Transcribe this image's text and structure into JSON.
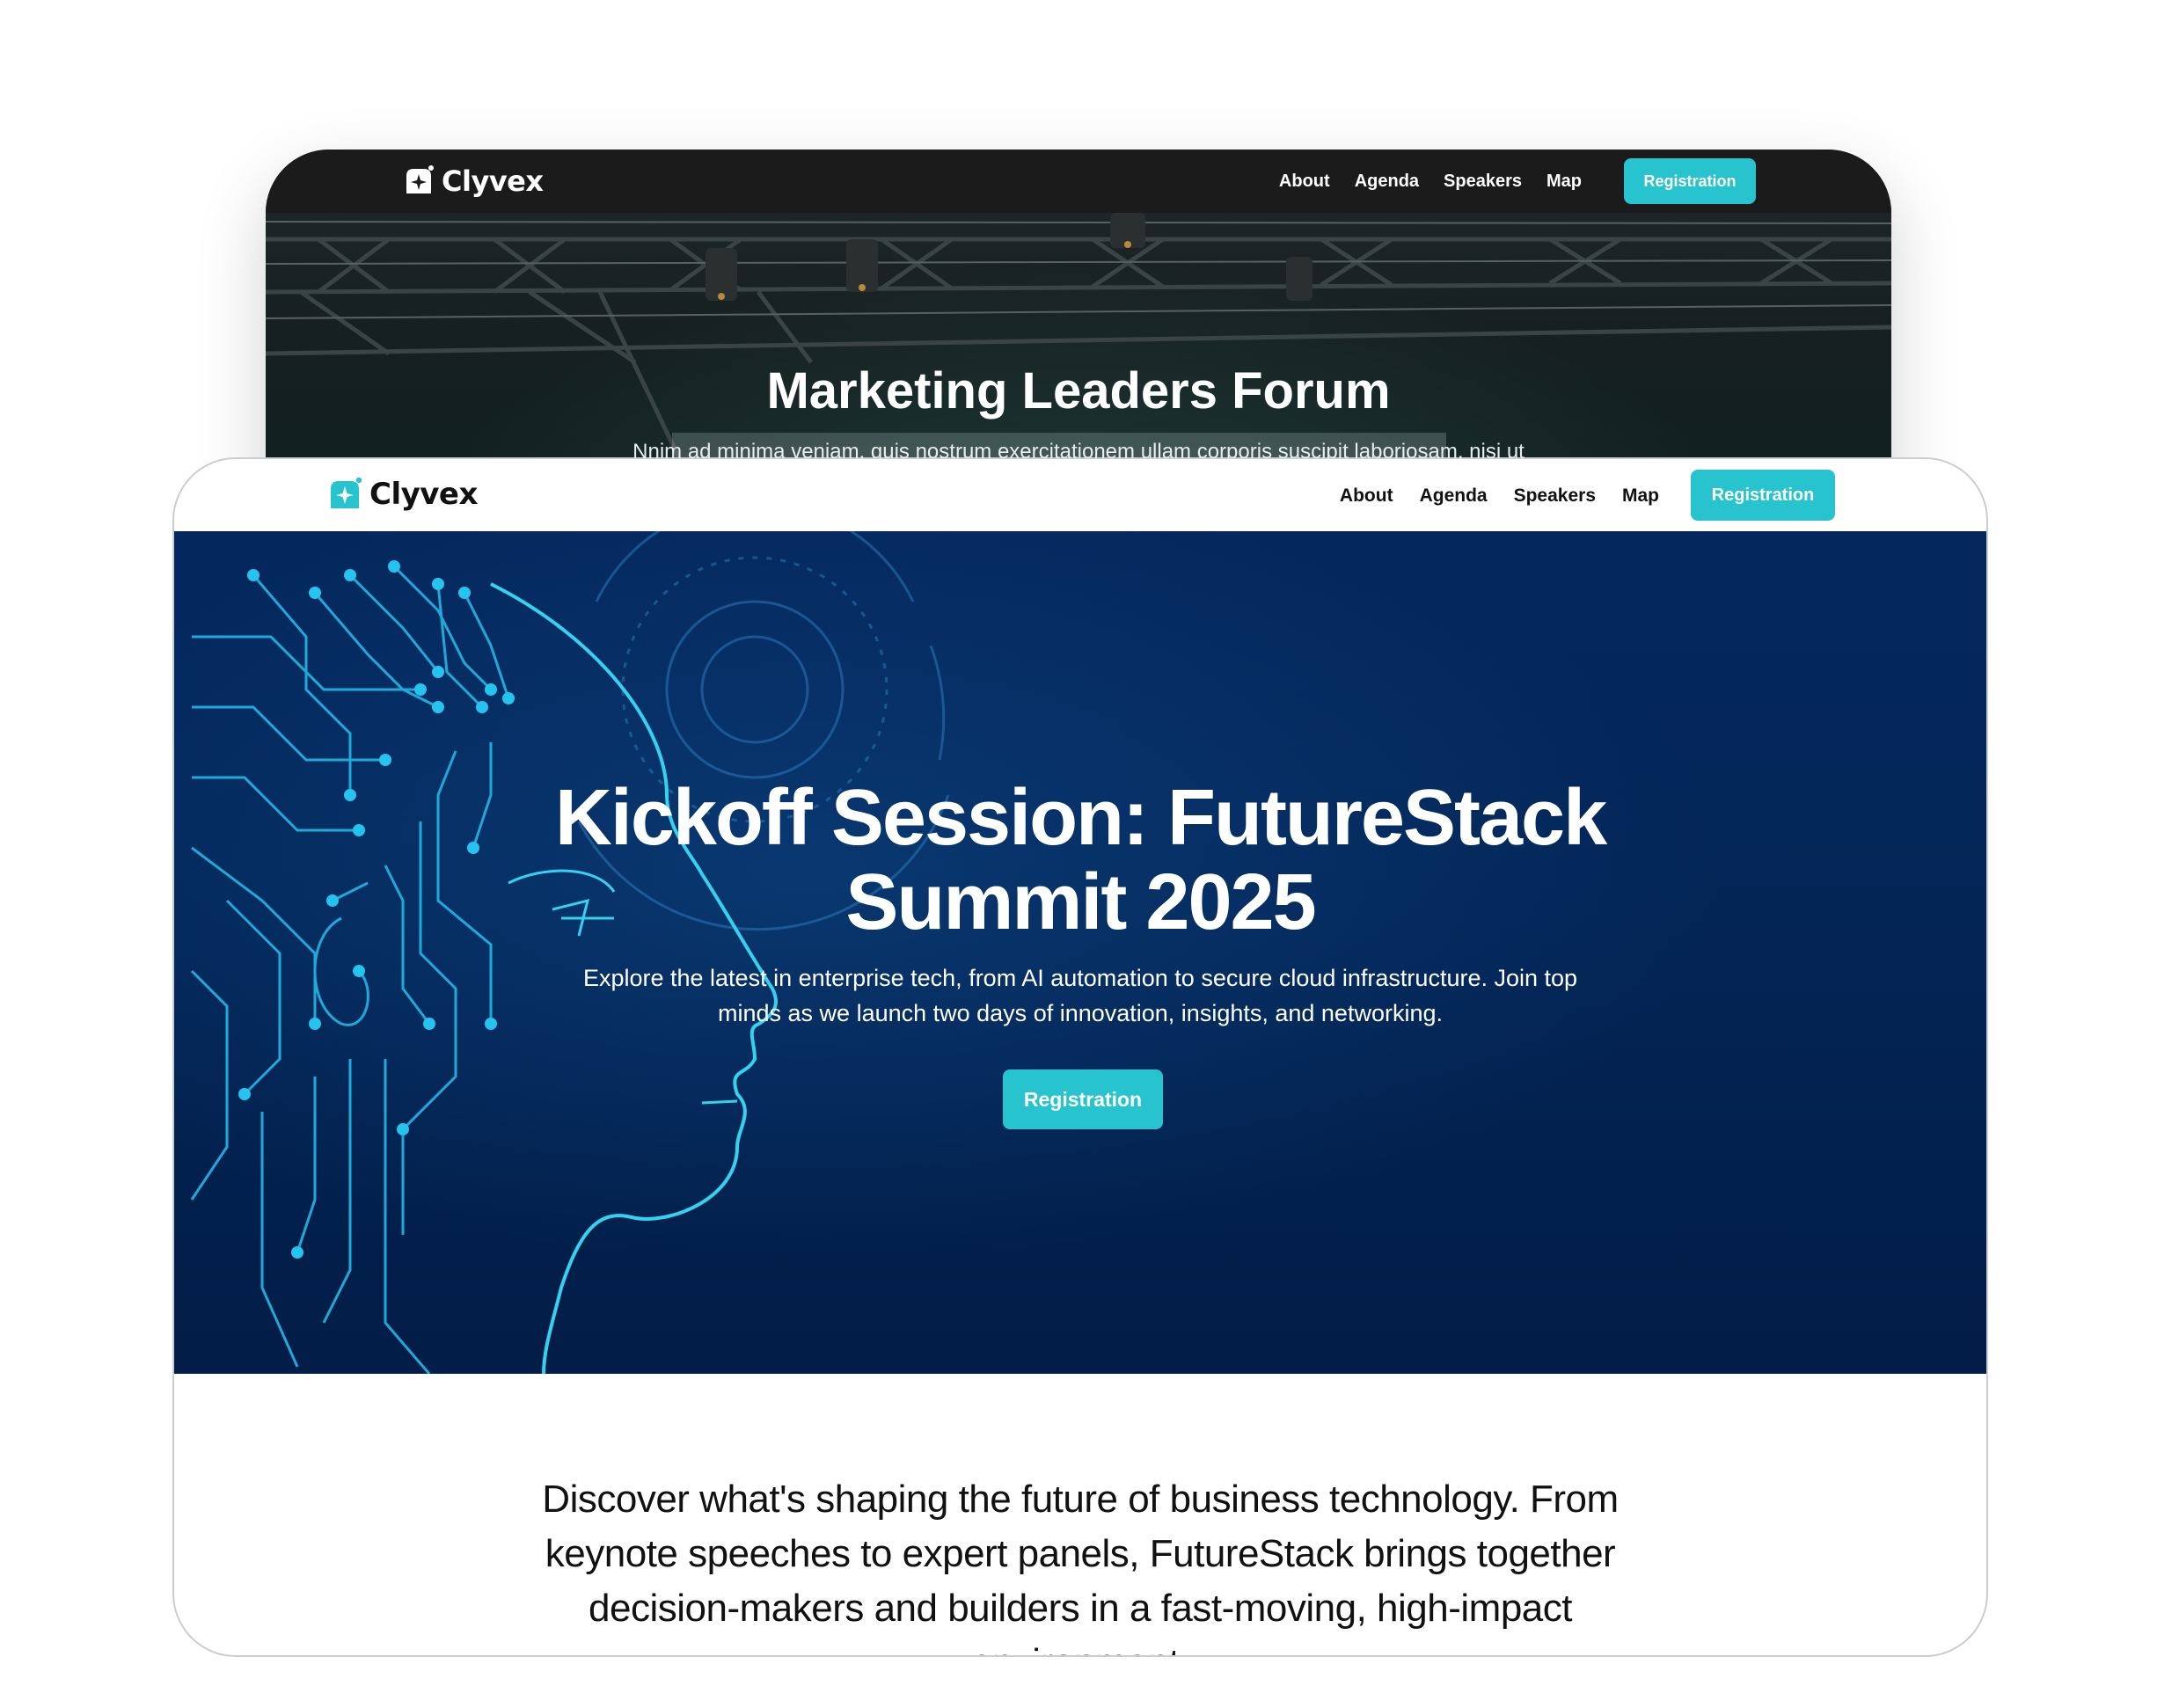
{
  "back_site": {
    "logo_text": "Clyvex",
    "nav_items": [
      "About",
      "Agenda",
      "Speakers",
      "Map"
    ],
    "registration_label": "Registration",
    "hero_title": "Marketing Leaders Forum",
    "hero_subtitle": "Nnim ad minima veniam, quis nostrum exercitationem ullam corporis suscipit laboriosam, nisi ut"
  },
  "front_site": {
    "logo_text": "Clyvex",
    "nav_items": [
      "About",
      "Agenda",
      "Speakers",
      "Map"
    ],
    "registration_label": "Registration",
    "hero": {
      "title_lines": [
        "Kickoff Session: FutureStack",
        "Summit 2025"
      ],
      "description_lines": [
        "Explore the latest in enterprise tech, from AI automation to secure cloud infrastructure. Join top",
        "minds as we launch two days of innovation, insights, and networking."
      ],
      "button_label": "Registration"
    },
    "intro_lines": [
      "Discover what's shaping the future of business technology. From",
      "keynote speeches to expert panels, FutureStack brings together",
      "decision-makers and builders in a fast-moving, high-impact",
      "environment."
    ]
  },
  "colors": {
    "accent": "#27c3cf",
    "back_nav": "#1b1b1c",
    "front_hero_bg": "#032556",
    "circuit_lines": "#1fb8e0"
  }
}
